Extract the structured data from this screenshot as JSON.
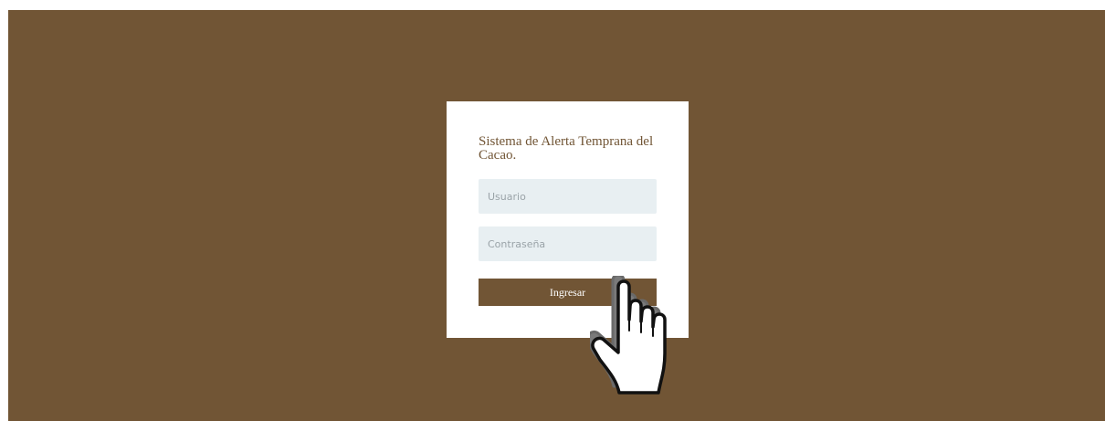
{
  "login": {
    "title": "Sistema de Alerta Temprana del Cacao.",
    "username_placeholder": "Usuario",
    "password_placeholder": "Contraseña",
    "submit_label": "Ingresar"
  },
  "cursor": {
    "icon": "hand-pointer-icon"
  },
  "colors": {
    "background": "#715535",
    "card": "#ffffff",
    "input_bg": "#e8eff2",
    "button": "#715535"
  }
}
